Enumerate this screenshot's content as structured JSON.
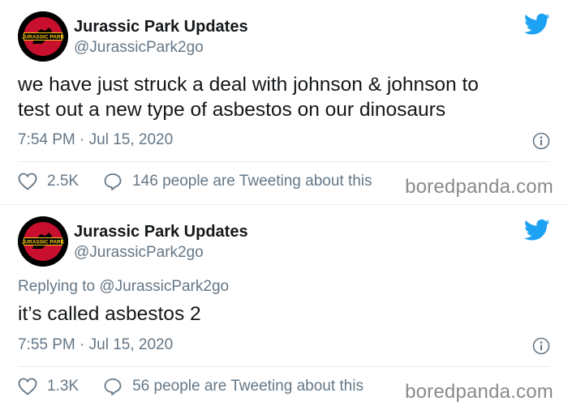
{
  "tweets": [
    {
      "display_name": "Jurassic Park Updates",
      "handle": "@JurassicPark2go",
      "avatar_logo_text": "JURASSIC PARK",
      "text_line1": "we have just struck a deal with johnson & johnson to",
      "text_line2": "test out a new type of asbestos on our dinosaurs",
      "timestamp": "7:54 PM · Jul 15, 2020",
      "like_count": "2.5K",
      "conversation_text": "146 people are Tweeting about this",
      "watermark": "boredpanda.com"
    },
    {
      "display_name": "Jurassic Park Updates",
      "handle": "@JurassicPark2go",
      "avatar_logo_text": "JURASSIC PARK",
      "reply_prefix": "Replying to ",
      "reply_mention": "@JurassicPark2go",
      "text_line1": "it’s called asbestos 2",
      "timestamp": "7:55 PM · Jul 15, 2020",
      "like_count": "1.3K",
      "conversation_text": "56 people are Tweeting about this",
      "watermark": "boredpanda.com"
    }
  ],
  "colors": {
    "twitter_blue": "#1da1f2",
    "secondary_text": "#657786",
    "primary_text": "#14171a",
    "avatar_red": "#c8102e",
    "avatar_yellow": "#f5c518"
  },
  "icons": {
    "brand": "twitter-bird-icon",
    "info": "info-icon",
    "like": "heart-icon",
    "reply": "speech-bubble-icon"
  }
}
